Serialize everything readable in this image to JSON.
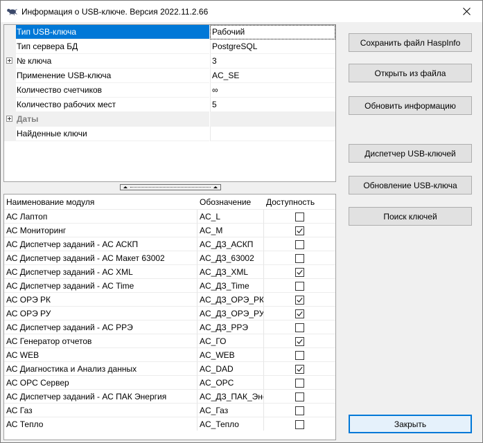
{
  "window": {
    "title": "Информация о USB-ключе. Версия 2022.11.2.66"
  },
  "properties": [
    {
      "name": "Тип USB-ключа",
      "value": "Рабочий",
      "selected": true,
      "expander": false,
      "category": false
    },
    {
      "name": "Тип сервера БД",
      "value": "PostgreSQL",
      "selected": false,
      "expander": false,
      "category": false
    },
    {
      "name": "№ ключа",
      "value": "3",
      "selected": false,
      "expander": true,
      "category": false
    },
    {
      "name": "Применение USB-ключа",
      "value": "AC_SE",
      "selected": false,
      "expander": false,
      "category": false
    },
    {
      "name": "Количество счетчиков",
      "value": "∞",
      "selected": false,
      "expander": false,
      "category": false
    },
    {
      "name": "Количество рабочих мест",
      "value": "5",
      "selected": false,
      "expander": false,
      "category": false
    },
    {
      "name": "Даты",
      "value": "",
      "selected": false,
      "expander": true,
      "category": true
    },
    {
      "name": "Найденные ключи",
      "value": "",
      "selected": false,
      "expander": false,
      "category": false
    }
  ],
  "modules": {
    "headers": {
      "name": "Наименование модуля",
      "code": "Обозначение",
      "available": "Доступность"
    },
    "rows": [
      {
        "name": "АС Лаптоп",
        "code": "AC_L",
        "checked": false
      },
      {
        "name": "АС Мониторинг",
        "code": "AC_M",
        "checked": true
      },
      {
        "name": "АС Диспетчер заданий - АС АСКП",
        "code": "AC_ДЗ_АСКП",
        "checked": false
      },
      {
        "name": "АС Диспетчер заданий - АС Макет 63002",
        "code": "AC_ДЗ_63002",
        "checked": false
      },
      {
        "name": "АС Диспетчер заданий - АС XML",
        "code": "AC_ДЗ_XML",
        "checked": true
      },
      {
        "name": "АС Диспетчер заданий - АС Time",
        "code": "AC_ДЗ_Time",
        "checked": false
      },
      {
        "name": "АС ОРЭ РК",
        "code": "AC_ДЗ_ОРЭ_РК",
        "checked": true
      },
      {
        "name": "АС ОРЭ РУ",
        "code": "AC_ДЗ_ОРЭ_РУ",
        "checked": true
      },
      {
        "name": "АС Диспетчер заданий - АС РРЭ",
        "code": "AC_ДЗ_РРЭ",
        "checked": false
      },
      {
        "name": "АС Генератор отчетов",
        "code": "AC_ГО",
        "checked": true
      },
      {
        "name": "АС WEB",
        "code": "AC_WEB",
        "checked": false
      },
      {
        "name": "АС Диагностика и Анализ данных",
        "code": "AC_DAD",
        "checked": true
      },
      {
        "name": "АС OPC Сервер",
        "code": "AC_OPC",
        "checked": false
      },
      {
        "name": "АС Диспетчер заданий - АС ПАК Энергия",
        "code": "AC_ДЗ_ПАК_Эне",
        "checked": false
      },
      {
        "name": "АС Газ",
        "code": "AC_Газ",
        "checked": false
      },
      {
        "name": "АС Тепло",
        "code": "AC_Тепло",
        "checked": false
      }
    ]
  },
  "buttons": {
    "save": "Сохранить файл HaspInfo",
    "open": "Открыть из файла",
    "refresh": "Обновить информацию",
    "manager": "Диспетчер USB-ключей",
    "update": "Обновление USB-ключа",
    "search": "Поиск ключей",
    "close": "Закрыть"
  },
  "colors": {
    "selection": "#0078d7",
    "window_bg": "#f0f0f0",
    "button_bg": "#e1e1e1"
  }
}
